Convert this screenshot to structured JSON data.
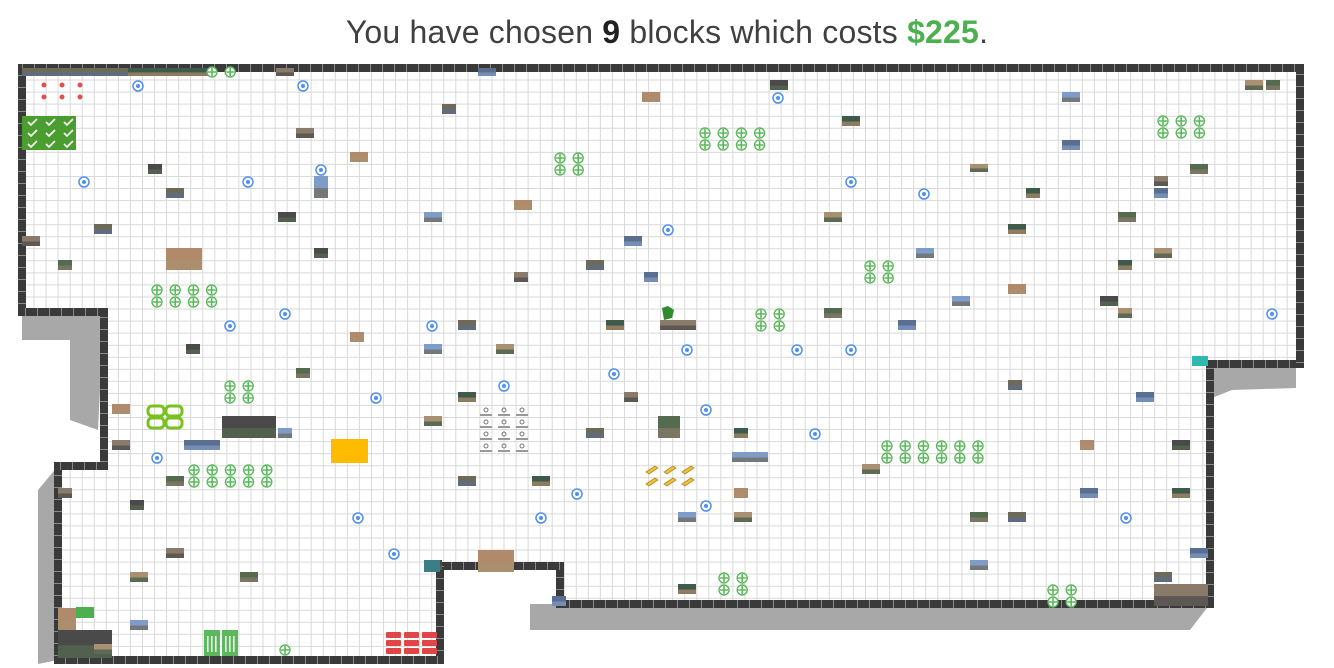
{
  "headline": {
    "prefix": "You have chosen",
    "block_count": "9",
    "middle": "blocks which costs",
    "price": "$225",
    "suffix": "."
  },
  "colors": {
    "price": "#4caf50",
    "border": "#3a3a3a",
    "shadow": "#a8a8a8",
    "grid_line": "#d9d9d9",
    "selected_block": "#ffbb00",
    "marker": "#4f8ff0",
    "sticker": "#5cb85c"
  },
  "icons": {
    "ad_photo": "photo-thumbnail",
    "ad_marker": "location-target-icon",
    "ad_sticker": "move-arrows-icon",
    "selection": "selected-block"
  }
}
